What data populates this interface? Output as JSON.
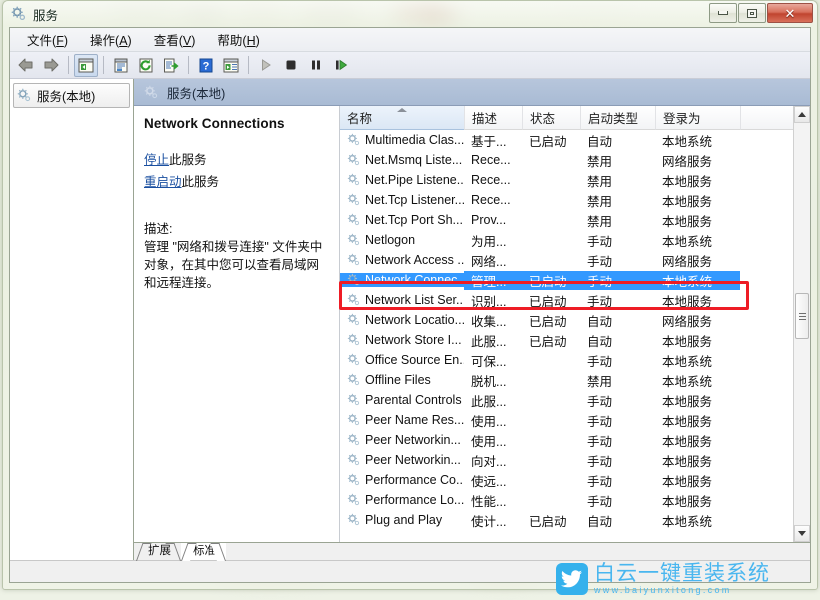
{
  "window": {
    "title": "服务",
    "title_icon": "services-gear-icon",
    "buttons": {
      "minimize": "minimize-button",
      "maximize": "maximize-button",
      "close": "✕"
    }
  },
  "menubar": [
    {
      "label": "文件",
      "accel": "F"
    },
    {
      "label": "操作",
      "accel": "A"
    },
    {
      "label": "查看",
      "accel": "V"
    },
    {
      "label": "帮助",
      "accel": "H"
    }
  ],
  "toolbar": [
    {
      "name": "back-button",
      "icon": "arrow-left-icon"
    },
    {
      "name": "forward-button",
      "icon": "arrow-right-icon"
    },
    {
      "name": "separator-1",
      "icon": "separator"
    },
    {
      "name": "show-hide-console-tree-button",
      "icon": "console-tree-icon",
      "pressed": true
    },
    {
      "name": "separator-2",
      "icon": "separator"
    },
    {
      "name": "properties-button",
      "icon": "properties-icon"
    },
    {
      "name": "refresh-button",
      "icon": "refresh-icon"
    },
    {
      "name": "export-list-button",
      "icon": "export-list-icon"
    },
    {
      "name": "separator-3",
      "icon": "separator"
    },
    {
      "name": "help-button",
      "icon": "help-question-icon"
    },
    {
      "name": "show-action-pane-button",
      "icon": "action-pane-icon"
    },
    {
      "name": "separator-4",
      "icon": "separator"
    },
    {
      "name": "start-service-button",
      "icon": "play-icon"
    },
    {
      "name": "stop-service-button",
      "icon": "stop-icon"
    },
    {
      "name": "pause-service-button",
      "icon": "pause-icon"
    },
    {
      "name": "restart-service-button",
      "icon": "restart-icon"
    }
  ],
  "tree": {
    "root_label": "服务(本地)",
    "root_icon": "services-gear-icon"
  },
  "pane": {
    "header_label": "服务(本地)",
    "header_icon": "services-gear-icon"
  },
  "detail": {
    "service_title": "Network Connections",
    "links": [
      {
        "link_text": "停止",
        "suffix": "此服务"
      },
      {
        "link_text": "重启动",
        "suffix": "此服务"
      }
    ],
    "description_label": "描述:",
    "description_text": "管理 \"网络和拨号连接\" 文件夹中对象，在其中您可以查看局域网和远程连接。"
  },
  "list": {
    "columns": [
      {
        "label": "名称",
        "sorted": true,
        "sort_direction": "ascending",
        "width": 124
      },
      {
        "label": "描述",
        "sorted": false,
        "width": 58
      },
      {
        "label": "状态",
        "sorted": false,
        "width": 58
      },
      {
        "label": "启动类型",
        "sorted": false,
        "width": 75
      },
      {
        "label": "登录为",
        "sorted": false,
        "width": 85
      },
      {
        "label": "",
        "sorted": false,
        "width": 42
      }
    ],
    "rows": [
      {
        "name": "Multimedia Clas...",
        "description": "基于...",
        "status": "已启动",
        "startup": "自动",
        "logon": "本地系统",
        "selected": false
      },
      {
        "name": "Net.Msmq Liste...",
        "description": "Rece...",
        "status": "",
        "startup": "禁用",
        "logon": "网络服务",
        "selected": false
      },
      {
        "name": "Net.Pipe Listene...",
        "description": "Rece...",
        "status": "",
        "startup": "禁用",
        "logon": "本地服务",
        "selected": false
      },
      {
        "name": "Net.Tcp Listener...",
        "description": "Rece...",
        "status": "",
        "startup": "禁用",
        "logon": "本地服务",
        "selected": false
      },
      {
        "name": "Net.Tcp Port Sh...",
        "description": "Prov...",
        "status": "",
        "startup": "禁用",
        "logon": "本地服务",
        "selected": false
      },
      {
        "name": "Netlogon",
        "description": "为用...",
        "status": "",
        "startup": "手动",
        "logon": "本地系统",
        "selected": false
      },
      {
        "name": "Network Access ...",
        "description": "网络...",
        "status": "",
        "startup": "手动",
        "logon": "网络服务",
        "selected": false
      },
      {
        "name": "Network Connec...",
        "description": "管理...",
        "status": "已启动",
        "startup": "手动",
        "logon": "本地系统",
        "selected": true
      },
      {
        "name": "Network List Ser...",
        "description": "识别...",
        "status": "已启动",
        "startup": "手动",
        "logon": "本地服务",
        "selected": false
      },
      {
        "name": "Network Locatio...",
        "description": "收集...",
        "status": "已启动",
        "startup": "自动",
        "logon": "网络服务",
        "selected": false
      },
      {
        "name": "Network Store I...",
        "description": "此服...",
        "status": "已启动",
        "startup": "自动",
        "logon": "本地服务",
        "selected": false
      },
      {
        "name": "Office Source En...",
        "description": "可保...",
        "status": "",
        "startup": "手动",
        "logon": "本地系统",
        "selected": false
      },
      {
        "name": "Offline Files",
        "description": "脱机...",
        "status": "",
        "startup": "禁用",
        "logon": "本地系统",
        "selected": false
      },
      {
        "name": "Parental Controls",
        "description": "此服...",
        "status": "",
        "startup": "手动",
        "logon": "本地服务",
        "selected": false
      },
      {
        "name": "Peer Name Res...",
        "description": "使用...",
        "status": "",
        "startup": "手动",
        "logon": "本地服务",
        "selected": false
      },
      {
        "name": "Peer Networkin...",
        "description": "使用...",
        "status": "",
        "startup": "手动",
        "logon": "本地服务",
        "selected": false
      },
      {
        "name": "Peer Networkin...",
        "description": "向对...",
        "status": "",
        "startup": "手动",
        "logon": "本地服务",
        "selected": false
      },
      {
        "name": "Performance Co...",
        "description": "使远...",
        "status": "",
        "startup": "手动",
        "logon": "本地服务",
        "selected": false
      },
      {
        "name": "Performance Lo...",
        "description": "性能...",
        "status": "",
        "startup": "手动",
        "logon": "本地服务",
        "selected": false
      },
      {
        "name": "Plug and Play",
        "description": "使计...",
        "status": "已启动",
        "startup": "自动",
        "logon": "本地系统",
        "selected": false
      }
    ]
  },
  "tabs": [
    {
      "label": "扩展",
      "active": false
    },
    {
      "label": "标准",
      "active": true
    }
  ],
  "annotation": {
    "type": "red-rectangle-highlight",
    "color": "#ee1c25"
  },
  "watermark": {
    "title": "白云一键重装系统",
    "url": "www.baiyunxitong.com",
    "badge_icon": "bird-icon",
    "color": "#49b6ef"
  }
}
